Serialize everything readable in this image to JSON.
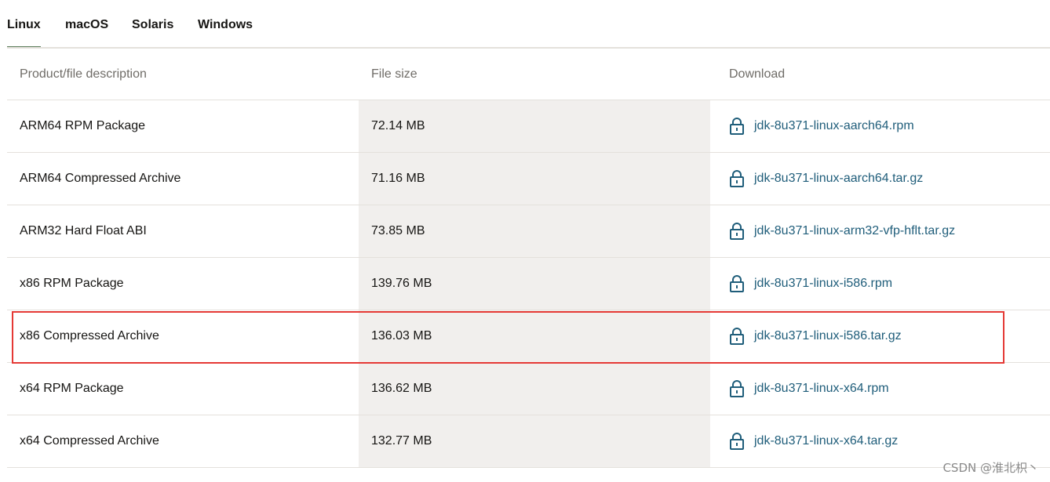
{
  "tabs": [
    {
      "label": "Linux",
      "active": true
    },
    {
      "label": "macOS",
      "active": false
    },
    {
      "label": "Solaris",
      "active": false
    },
    {
      "label": "Windows",
      "active": false
    }
  ],
  "table": {
    "headers": {
      "description": "Product/file description",
      "size": "File size",
      "download": "Download"
    },
    "rows": [
      {
        "description": "ARM64 RPM Package",
        "size": "72.14 MB",
        "file": "jdk-8u371-linux-aarch64.rpm"
      },
      {
        "description": "ARM64 Compressed Archive",
        "size": "71.16 MB",
        "file": "jdk-8u371-linux-aarch64.tar.gz"
      },
      {
        "description": "ARM32 Hard Float ABI",
        "size": "73.85 MB",
        "file": "jdk-8u371-linux-arm32-vfp-hflt.tar.gz"
      },
      {
        "description": "x86 RPM Package",
        "size": "139.76 MB",
        "file": "jdk-8u371-linux-i586.rpm"
      },
      {
        "description": "x86 Compressed Archive",
        "size": "136.03 MB",
        "file": "jdk-8u371-linux-i586.tar.gz"
      },
      {
        "description": "x64 RPM Package",
        "size": "136.62 MB",
        "file": "jdk-8u371-linux-x64.rpm"
      },
      {
        "description": "x64 Compressed Archive",
        "size": "132.77 MB",
        "file": "jdk-8u371-linux-x64.tar.gz"
      }
    ]
  },
  "highlighted_row": "x86 Compressed Archive",
  "icons": {
    "download": "lock-icon"
  },
  "colors": {
    "link": "#1f5d7a",
    "active_tab_underline": "#5c7c5a",
    "size_column_bg": "#f1efed",
    "highlight_border": "#e53935"
  },
  "watermark": "CSDN @淮北枳丶"
}
